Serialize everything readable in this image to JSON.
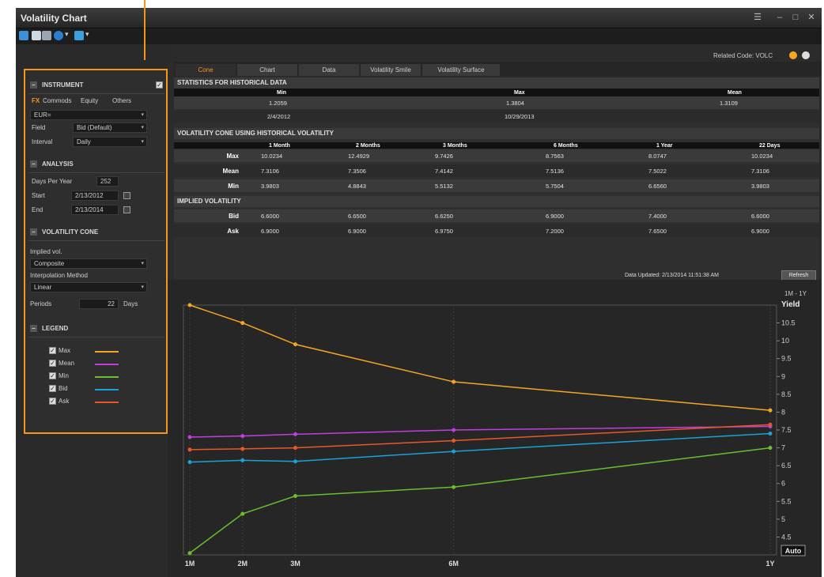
{
  "window": {
    "title": "Volatility Chart"
  },
  "header": {
    "related_code": "Related Code: VOLC"
  },
  "tabs": [
    "Cone",
    "Chart",
    "Data",
    "Volatility Smile",
    "Volatility Surface"
  ],
  "left_panel": {
    "instrument": {
      "heading": "INSTRUMENT",
      "asset_tabs": [
        "FX",
        "Commods",
        "Equity",
        "Others"
      ],
      "ric_value": "EUR=",
      "field_label": "Field",
      "field_value": "Bid (Default)",
      "interval_label": "Interval",
      "interval_value": "Daily"
    },
    "analysis": {
      "heading": "ANALYSIS",
      "days_per_year_label": "Days Per Year",
      "days_per_year_value": "252",
      "start_label": "Start",
      "start_value": "2/13/2012",
      "end_label": "End",
      "end_value": "2/13/2014"
    },
    "volatility_cone": {
      "heading": "VOLATILITY CONE",
      "implied_vol_label": "Implied vol.",
      "implied_vol_value": "Composite",
      "interp_label": "Interpolation Method",
      "interp_value": "Linear",
      "periods_label": "Periods",
      "periods_value": "22",
      "periods_unit": "Days"
    },
    "legend": {
      "heading": "LEGEND",
      "items": [
        {
          "label": "Max",
          "color": "#f5a623"
        },
        {
          "label": "Mean",
          "color": "#c33ee0"
        },
        {
          "label": "Min",
          "color": "#6abf2e"
        },
        {
          "label": "Bid",
          "color": "#1ba1d9"
        },
        {
          "label": "Ask",
          "color": "#e8562a"
        }
      ]
    }
  },
  "stats": {
    "title": "STATISTICS FOR HISTORICAL DATA",
    "headers": [
      "Min",
      "Max",
      "Mean"
    ],
    "row1": [
      "1.2059",
      "1.3804",
      "1.3109"
    ],
    "row2": [
      "2/4/2012",
      "10/29/2013"
    ]
  },
  "cone": {
    "title": "VOLATILITY CONE USING HISTORICAL VOLATILITY",
    "headers": [
      "1 Month",
      "2 Months",
      "3 Months",
      "6 Months",
      "1 Year",
      "22 Days"
    ],
    "rows": [
      {
        "label": "Max",
        "values": [
          "10.0234",
          "12.4929",
          "9.7426",
          "8.7563",
          "8.0747",
          "10.0234"
        ]
      },
      {
        "label": "Mean",
        "values": [
          "7.3106",
          "7.3506",
          "7.4142",
          "7.5136",
          "7.5022",
          "7.3106"
        ]
      },
      {
        "label": "Min",
        "values": [
          "3.9803",
          "4.8843",
          "5.5132",
          "5.7504",
          "6.6560",
          "3.9803"
        ]
      }
    ]
  },
  "implied": {
    "title": "IMPLIED VOLATILITY",
    "rows": [
      {
        "label": "Bid",
        "values": [
          "6.6000",
          "6.6500",
          "6.6250",
          "6.9000",
          "7.4000",
          "6.6000"
        ]
      },
      {
        "label": "Ask",
        "values": [
          "6.9000",
          "6.9000",
          "6.9750",
          "7.2000",
          "7.6500",
          "6.9000"
        ]
      }
    ]
  },
  "update": {
    "text": "Data Updated: 2/13/2014 11:51:38 AM",
    "refresh_label": "Refresh"
  },
  "chart_data": {
    "type": "line",
    "x": [
      "1M",
      "2M",
      "3M",
      "6M",
      "1Y"
    ],
    "x_positions_months": [
      1,
      2,
      3,
      6,
      12
    ],
    "ylabel": "Yield",
    "ylim": [
      4,
      11
    ],
    "yticks": [
      "4.5",
      "5",
      "5.5",
      "6",
      "6.5",
      "7",
      "7.5",
      "8",
      "8.5",
      "9",
      "9.5",
      "10",
      "10.5"
    ],
    "range_label": "1M - 1Y",
    "auto_label": "Auto",
    "series": [
      {
        "name": "Max",
        "color": "#f5a623",
        "values": [
          11.0,
          10.5,
          9.9,
          8.85,
          8.05
        ]
      },
      {
        "name": "Mean",
        "color": "#c33ee0",
        "values": [
          7.3,
          7.33,
          7.38,
          7.5,
          7.6
        ]
      },
      {
        "name": "Min",
        "color": "#6abf2e",
        "values": [
          4.05,
          5.15,
          5.65,
          5.9,
          7.0
        ]
      },
      {
        "name": "Bid",
        "color": "#1ba1d9",
        "values": [
          6.6,
          6.65,
          6.62,
          6.9,
          7.4
        ]
      },
      {
        "name": "Ask",
        "color": "#e8562a",
        "values": [
          6.95,
          6.97,
          7.0,
          7.2,
          7.65
        ]
      }
    ]
  }
}
